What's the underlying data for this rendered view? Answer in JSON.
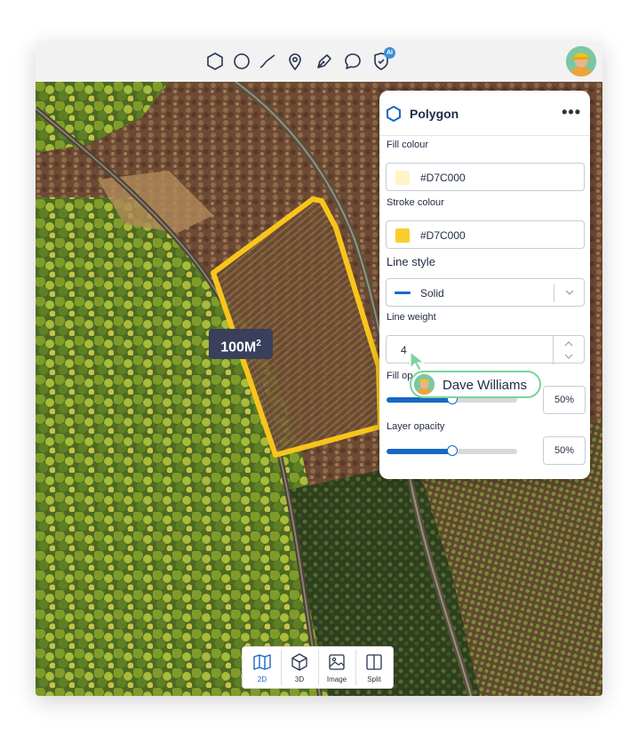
{
  "toolbar": {
    "tools": [
      {
        "icon": "hexagon-icon"
      },
      {
        "icon": "circle-icon"
      },
      {
        "icon": "line-icon"
      },
      {
        "icon": "map-pin-icon"
      },
      {
        "icon": "pen-icon"
      },
      {
        "icon": "comment-icon"
      },
      {
        "icon": "shield-ai-icon",
        "badge": "AI"
      }
    ]
  },
  "map": {
    "area_value": "100M",
    "area_unit_exponent": "2"
  },
  "panel": {
    "title": "Polygon",
    "more_label": "•••",
    "fill_colour_label": "Fill colour",
    "fill_colour_value": "#D7C000",
    "fill_swatch": "#FFF3C8",
    "stroke_colour_label": "Stroke colour",
    "stroke_colour_value": "#D7C000",
    "stroke_swatch": "#F8CE2F",
    "line_style_label": "Line style",
    "line_style_value": "Solid",
    "line_weight_label": "Line weight",
    "line_weight_value": "4",
    "fill_opacity_label": "Fill op",
    "fill_opacity_value": "50%",
    "fill_opacity_level": 0.5,
    "layer_opacity_label": "Layer opacity",
    "layer_opacity_value": "50%",
    "layer_opacity_level": 0.5
  },
  "presence": {
    "name": "Dave Williams"
  },
  "view_modes": [
    {
      "label": "2D",
      "icon": "map-icon",
      "active": true
    },
    {
      "label": "3D",
      "icon": "cube-icon",
      "active": false
    },
    {
      "label": "Image",
      "icon": "image-icon",
      "active": false
    },
    {
      "label": "Split",
      "icon": "split-view-icon",
      "active": false
    }
  ],
  "colors": {
    "accent": "#1769C5",
    "polygon_stroke": "#F8C51C",
    "presence_border": "#7AD39E"
  }
}
